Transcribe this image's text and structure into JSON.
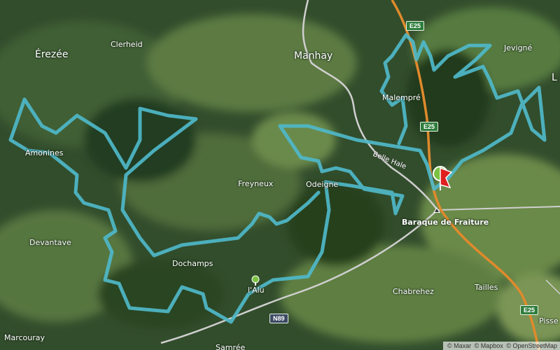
{
  "places": [
    {
      "id": "erezee",
      "name": "Érezée"
    },
    {
      "id": "clerheid",
      "name": "Clerheid"
    },
    {
      "id": "manhay",
      "name": "Manhay"
    },
    {
      "id": "jevigne",
      "name": "Jevigné"
    },
    {
      "id": "l-edge",
      "name": "L"
    },
    {
      "id": "malempre",
      "name": "Malempré"
    },
    {
      "id": "amonines",
      "name": "Amonines"
    },
    {
      "id": "freyneux",
      "name": "Freyneux"
    },
    {
      "id": "odeigne",
      "name": "Odeigne"
    },
    {
      "id": "baraque",
      "name": "Baraque de Fraiture"
    },
    {
      "id": "devantave",
      "name": "Devantave"
    },
    {
      "id": "dochamps",
      "name": "Dochamps"
    },
    {
      "id": "alu",
      "name": "l'Alu"
    },
    {
      "id": "chabrehez",
      "name": "Chabrehez"
    },
    {
      "id": "tailles",
      "name": "Tailles"
    },
    {
      "id": "marcouray",
      "name": "Marcouray"
    },
    {
      "id": "pisse",
      "name": "Pisse"
    },
    {
      "id": "samree",
      "name": "Samrée"
    }
  ],
  "road_shields": [
    {
      "id": "e25-top",
      "label": "E25"
    },
    {
      "id": "e25-mid",
      "label": "E25"
    },
    {
      "id": "e25-bottom",
      "label": "E25"
    },
    {
      "id": "n89",
      "label": "N89"
    }
  ],
  "road_names": {
    "belle_hale": "Belle Hale"
  },
  "attribution": [
    "© Maxar",
    "© Mapbox",
    "© OpenStreetMap"
  ],
  "icons": {
    "start": "start-flag-marker-icon",
    "poi": "tree-poi-icon",
    "summit": "summit-icon"
  },
  "colors": {
    "route": "#4fb8c9",
    "motorway": "#e08a2c",
    "road": "#d8d8d8",
    "forest": "#2b4626",
    "field": "#5c7a3e"
  }
}
